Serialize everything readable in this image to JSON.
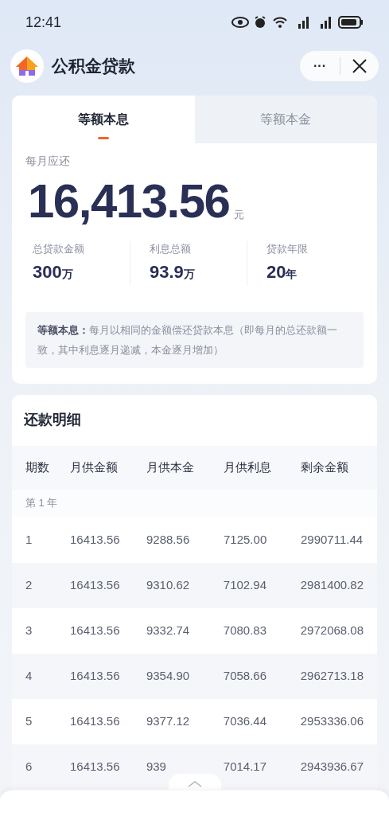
{
  "status_bar": {
    "time": "12:41"
  },
  "header": {
    "title": "公积金贷款",
    "more": "···"
  },
  "tabs": [
    {
      "label": "等额本息",
      "selected": true
    },
    {
      "label": "等额本金",
      "selected": false
    }
  ],
  "summary": {
    "label": "每月应还",
    "amount": "16,413.56",
    "unit": "元",
    "stats": [
      {
        "label": "总贷款金额",
        "value": "300",
        "unit": "万"
      },
      {
        "label": "利息总额",
        "value": "93.9",
        "unit": "万"
      },
      {
        "label": "贷款年限",
        "value": "20",
        "unit": "年"
      }
    ],
    "note": "**等额本息：**每月以相同的金额偿还贷款本息（即每月的总还款额一致，其中利息逐月递减，本金逐月增加）"
  },
  "details": {
    "title": "还款明细",
    "columns": [
      "期数",
      "月供金额",
      "月供本金",
      "月供利息",
      "剩余金额"
    ],
    "group": "第 1 年",
    "rows": [
      [
        "1",
        "16413.56",
        "9288.56",
        "7125.00",
        "2990711.44"
      ],
      [
        "2",
        "16413.56",
        "9310.62",
        "7102.94",
        "2981400.82"
      ],
      [
        "3",
        "16413.56",
        "9332.74",
        "7080.83",
        "2972068.08"
      ],
      [
        "4",
        "16413.56",
        "9354.90",
        "7058.66",
        "2962713.18"
      ],
      [
        "5",
        "16413.56",
        "9377.12",
        "7036.44",
        "2953336.06"
      ],
      [
        "6",
        "16413.56",
        "939",
        "7014.17",
        "2943936.67"
      ]
    ]
  }
}
